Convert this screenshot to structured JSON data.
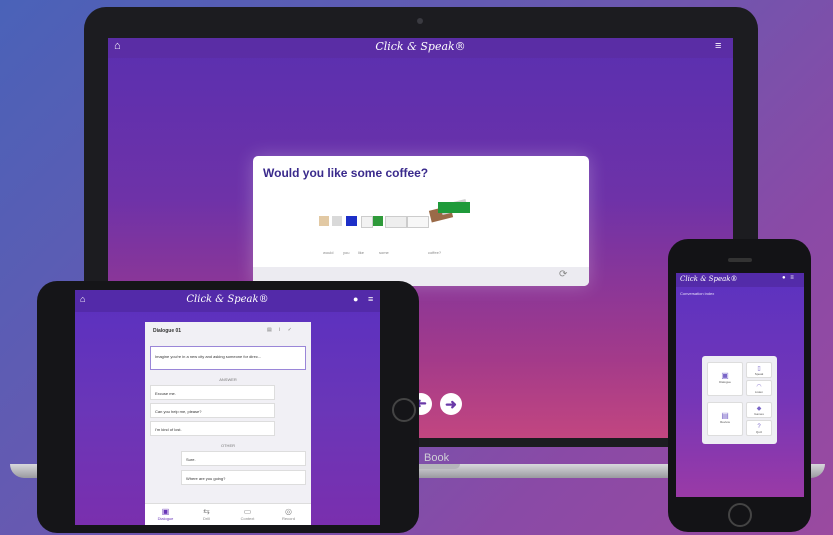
{
  "laptop": {
    "app_logo": "Click & Speak®",
    "home_icon": "home-icon",
    "menu_icon": "menu-icon",
    "question": "Would you like some coffee?",
    "word_labels": [
      "would",
      "you",
      "like",
      "some",
      "coffee?"
    ],
    "next_arrow": "➜",
    "prev_arrow": "➜",
    "brand_fragment": "Book"
  },
  "tablet": {
    "app_logo": "Click & Speak®",
    "dialogue_title": "Dialogue 01",
    "intro_text": "Imagine you're in a new city and asking someone for direc...",
    "separator_1": "ANSWER",
    "answers": [
      "Excuse me.",
      "Can you help me, please?",
      "I'm kind of lost."
    ],
    "separator_2": "OTHER",
    "replies": [
      "Sure.",
      "Where are you going?"
    ],
    "bottom_nav": [
      "Dialogue",
      "Drill",
      "Context",
      "Record"
    ]
  },
  "phone": {
    "app_logo": "Click & Speak®",
    "subtitle": "Conversation index",
    "tiles": [
      "Dialogue",
      "Speak",
      "Listen",
      "Review",
      "Games",
      "Quiz"
    ]
  },
  "colors": {
    "accent": "#6a36b8",
    "brand_dark": "#3a2a8c"
  }
}
